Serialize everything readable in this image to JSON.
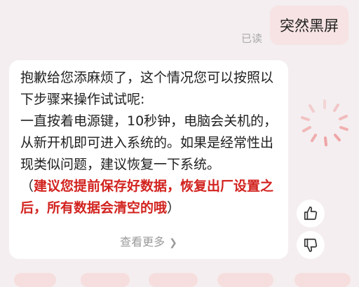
{
  "chat": {
    "user_message": "突然黑屏",
    "read_status": "已读",
    "reply": {
      "line1": "抱歉给您添麻烦了，这个情况您可以按照以下步骤来操作试试呢:",
      "line2": "一直按着电源键，10秒钟，电脑会关机的，从新开机即可进入系统的。如果是经常性出现类似问题，建议恢复一下系统。",
      "paren_open": "（",
      "warning": "建议您提前保存好数据，恢复出厂设置之后，所有数据会清空的哦",
      "paren_close": "）"
    },
    "view_more": "查看更多",
    "view_more_icon": "chevron-right-icon"
  },
  "actions": {
    "like_icon": "thumbs-up-icon",
    "dislike_icon": "thumbs-down-icon"
  },
  "colors": {
    "background": "#f4eef0",
    "user_bubble": "#f7e3e3",
    "warning_text": "#d2231f",
    "muted_text": "#a9a9a9"
  }
}
